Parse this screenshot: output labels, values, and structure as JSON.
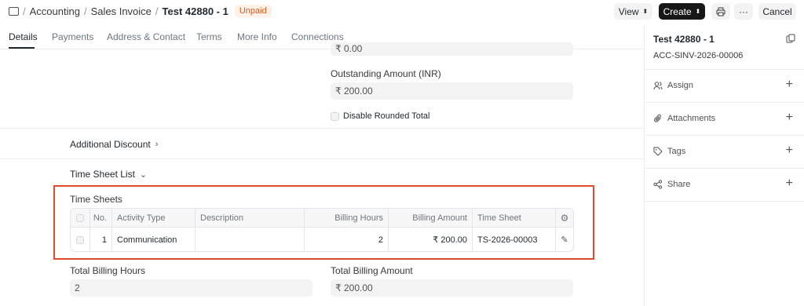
{
  "breadcrumb": {
    "module": "Accounting",
    "doctype": "Sales Invoice",
    "doc_title": "Test 42880 - 1",
    "status": "Unpaid",
    "status_color": "#d85a1a"
  },
  "toolbar": {
    "view_label": "View",
    "create_label": "Create",
    "cancel_label": "Cancel"
  },
  "tabs": [
    "Details",
    "Payments",
    "Address & Contact",
    "Terms",
    "More Info",
    "Connections"
  ],
  "main": {
    "top_partial_value": "₹ 0.00",
    "outstanding_label": "Outstanding Amount (INR)",
    "outstanding_value": "₹ 200.00",
    "disable_rounded_label": "Disable Rounded Total",
    "additional_discount_label": "Additional Discount",
    "timesheet_list_label": "Time Sheet List",
    "time_sheets_label": "Time Sheets",
    "total_billing_hours_label": "Total Billing Hours",
    "total_billing_hours_value": "2",
    "total_billing_amount_label": "Total Billing Amount",
    "total_billing_amount_value": "₹ 200.00"
  },
  "grid": {
    "headers": [
      "No.",
      "Activity Type",
      "Description",
      "Billing Hours",
      "Billing Amount",
      "Time Sheet"
    ],
    "rows": [
      {
        "no": "1",
        "activity": "Communication",
        "description": "",
        "hours": "2",
        "amount": "₹ 200.00",
        "timesheet": "TS-2026-00003"
      }
    ]
  },
  "sidebar": {
    "title": "Test 42880 - 1",
    "doc_name": "ACC-SINV-2026-00006",
    "items": [
      "Assign",
      "Attachments",
      "Tags",
      "Share"
    ]
  },
  "colors": {
    "highlight": "#e14a2b",
    "primary_button": "#171717"
  }
}
